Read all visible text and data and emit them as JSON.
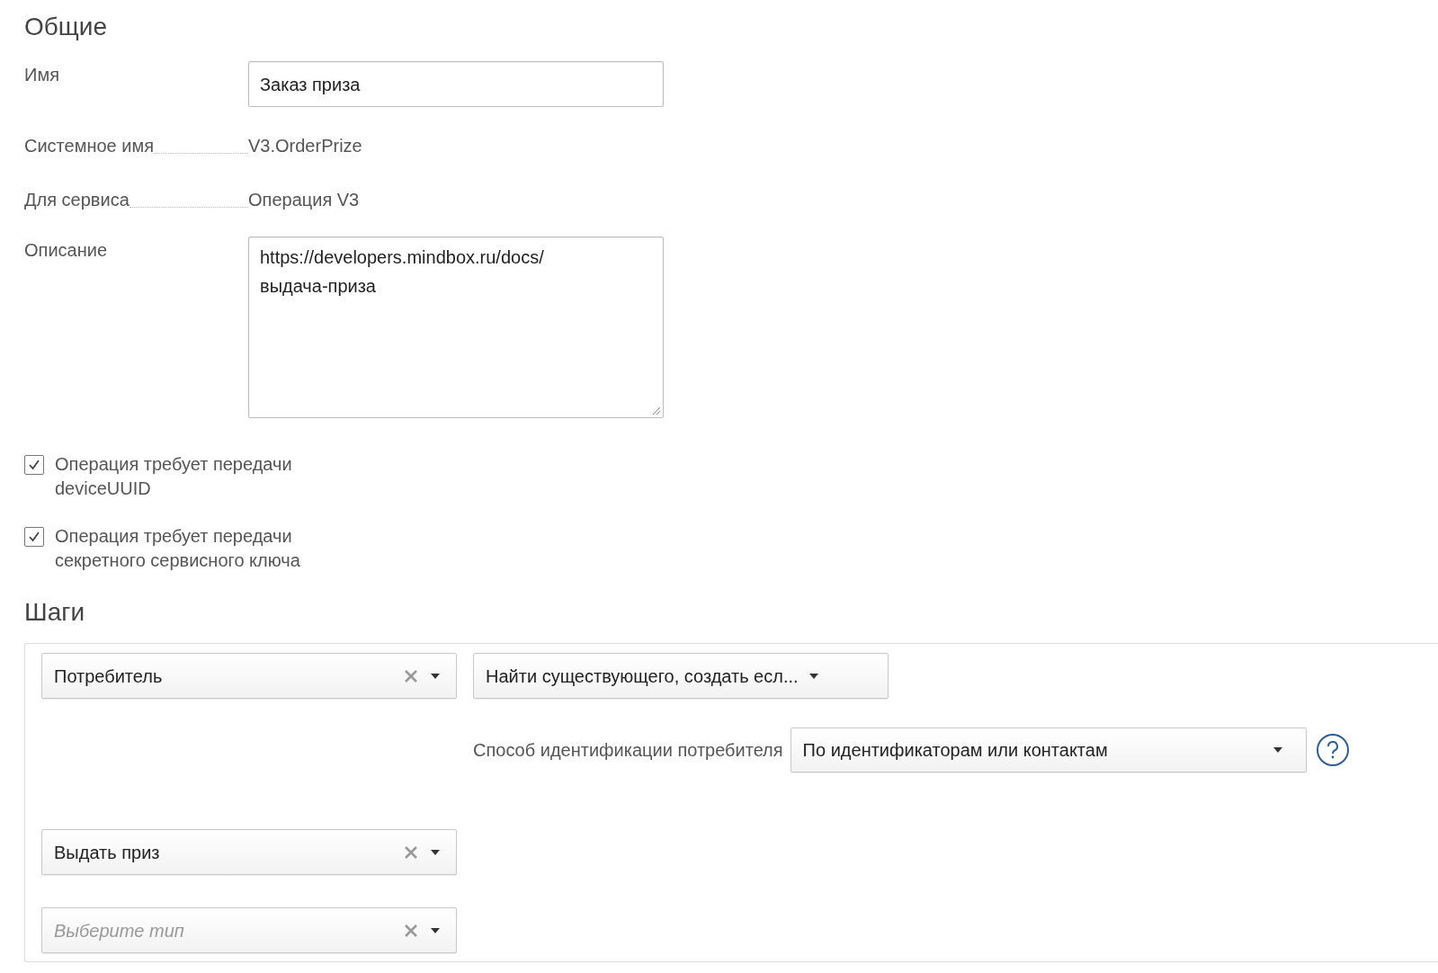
{
  "general": {
    "title": "Общие",
    "name": {
      "label": "Имя",
      "value": "Заказ приза"
    },
    "system_name": {
      "label": "Системное имя",
      "value": "V3.OrderPrize"
    },
    "service": {
      "label": "Для сервиса",
      "value": "Операция V3"
    },
    "description": {
      "label": "Описание",
      "value": "https://developers.mindbox.ru/docs/\nвыдача-приза"
    },
    "checkboxes": [
      {
        "label": "Операция требует передачи deviceUUID",
        "checked": true
      },
      {
        "label": "Операция требует передачи секретного сервисного ключа",
        "checked": true
      }
    ]
  },
  "steps": {
    "title": "Шаги",
    "items": [
      {
        "type": {
          "value": "Потребитель"
        },
        "action": {
          "value": "Найти существующего, создать есл..."
        },
        "option": {
          "label": "Способ идентификации потребителя",
          "value": "По идентификаторам или контактам"
        }
      },
      {
        "type": {
          "value": "Выдать приз"
        }
      },
      {
        "type": {
          "placeholder": "Выберите тип"
        }
      }
    ]
  }
}
